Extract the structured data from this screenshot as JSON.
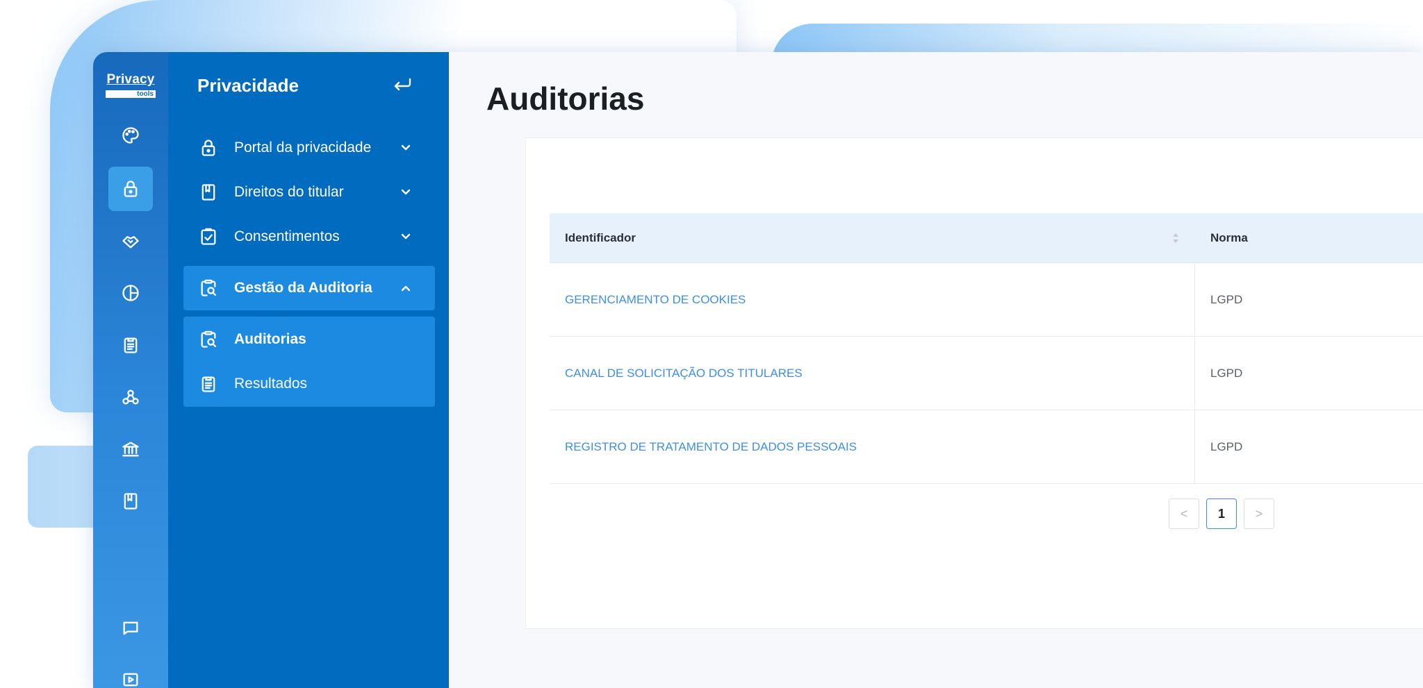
{
  "logo": {
    "top": "Privacy",
    "bottom": "tools"
  },
  "rail": {
    "icons": [
      {
        "name": "palette-icon"
      },
      {
        "name": "lock-icon",
        "active": true
      },
      {
        "name": "handshake-icon"
      },
      {
        "name": "pie-chart-icon"
      },
      {
        "name": "clipboard-list-icon"
      },
      {
        "name": "webhook-icon"
      },
      {
        "name": "bank-icon"
      },
      {
        "name": "book-icon"
      },
      {
        "name": "chat-icon"
      },
      {
        "name": "video-icon"
      }
    ]
  },
  "sidebar": {
    "title": "Privacidade",
    "back_icon": "return-arrow-icon",
    "items": [
      {
        "label": "Portal da privacidade",
        "icon": "lock-icon",
        "expanded": false
      },
      {
        "label": "Direitos do titular",
        "icon": "bookmark-book-icon",
        "expanded": false
      },
      {
        "label": "Consentimentos",
        "icon": "clipboard-check-icon",
        "expanded": false
      },
      {
        "label": "Gestão da Auditoria",
        "icon": "clipboard-search-icon",
        "expanded": true
      }
    ],
    "submenu": [
      {
        "label": "Auditorias",
        "icon": "clipboard-search-icon",
        "current": true
      },
      {
        "label": "Resultados",
        "icon": "clipboard-list-icon",
        "current": false
      }
    ]
  },
  "main": {
    "title": "Auditorias",
    "table": {
      "columns": [
        "Identificador",
        "Norma"
      ],
      "rows": [
        {
          "identificador": "GERENCIAMENTO DE COOKIES",
          "norma": "LGPD"
        },
        {
          "identificador": "CANAL DE SOLICITAÇÃO DOS TITULARES",
          "norma": "LGPD"
        },
        {
          "identificador": "REGISTRO DE TRATAMENTO DE DADOS PESSOAIS",
          "norma": "LGPD"
        }
      ]
    },
    "pagination": {
      "prev": "<",
      "current_page": "1",
      "next": ">"
    }
  },
  "colors": {
    "rail": "#1769bc",
    "sidebar": "#006bbf",
    "sidebar_active": "#1b8ae0",
    "link": "#3d8fe3",
    "table_header": "#e7f1fb"
  }
}
